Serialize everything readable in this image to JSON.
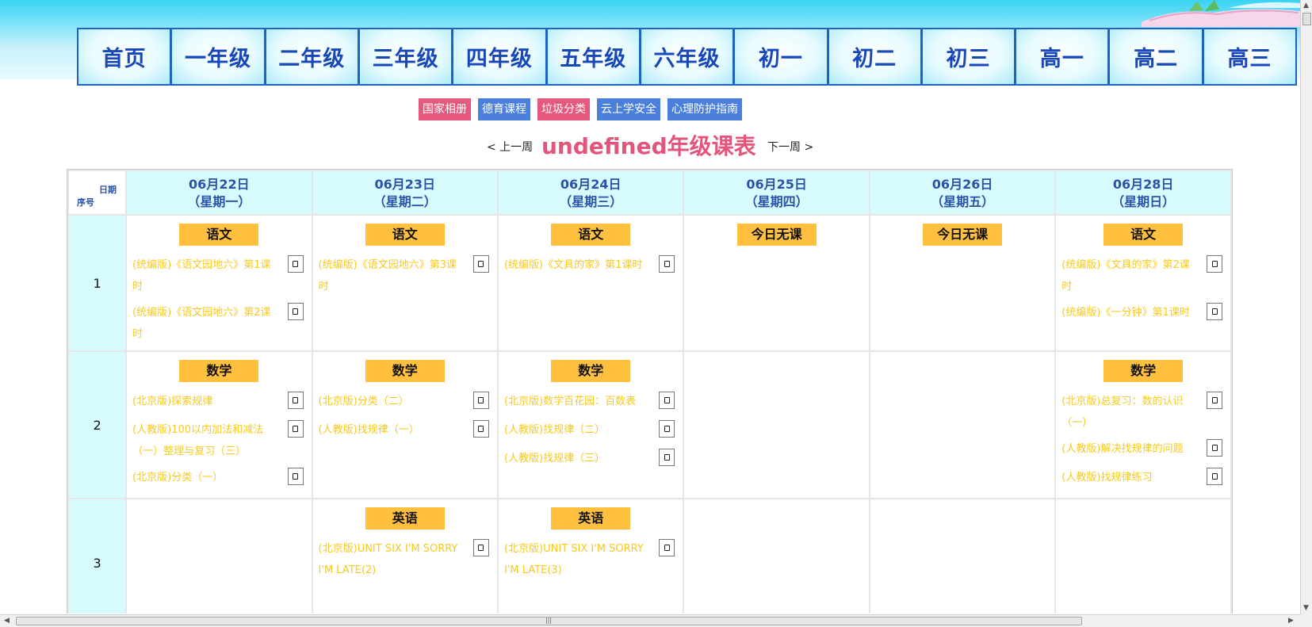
{
  "nav": {
    "tabs": [
      "首页",
      "一年级",
      "二年级",
      "三年级",
      "四年级",
      "五年级",
      "六年级",
      "初一",
      "初二",
      "初三",
      "高一",
      "高二",
      "高三"
    ]
  },
  "links": [
    {
      "label": "国家相册",
      "color": "#e6587e"
    },
    {
      "label": "德育课程",
      "color": "#4a7fdc"
    },
    {
      "label": "垃圾分类",
      "color": "#e6587e"
    },
    {
      "label": "云上学安全",
      "color": "#4a7fdc"
    },
    {
      "label": "心理防护指南",
      "color": "#4a7fdc"
    }
  ],
  "week": {
    "prev_label": "< 上一周",
    "title": "undefined年级课表",
    "next_label": "下一周 >"
  },
  "table": {
    "corner_date": "日期",
    "corner_index": "序号",
    "days": [
      {
        "date": "06月22日",
        "weekday": "（星期一）"
      },
      {
        "date": "06月23日",
        "weekday": "（星期二）"
      },
      {
        "date": "06月24日",
        "weekday": "（星期三）"
      },
      {
        "date": "06月25日",
        "weekday": "（星期四）"
      },
      {
        "date": "06月26日",
        "weekday": "（星期五）"
      },
      {
        "date": "06月28日",
        "weekday": "（星期日）"
      }
    ],
    "rows": [
      {
        "index": "1",
        "cells": [
          {
            "subject": "语文",
            "lessons": [
              "(统编版)《语文园地六》第1课时",
              "(统编版)《语文园地六》第2课时"
            ]
          },
          {
            "subject": "语文",
            "lessons": [
              "(统编版)《语文园地六》第3课时"
            ]
          },
          {
            "subject": "语文",
            "lessons": [
              "(统编版)《文具的家》第1课时"
            ]
          },
          {
            "subject": "今日无课",
            "lessons": []
          },
          {
            "subject": "今日无课",
            "lessons": []
          },
          {
            "subject": "语文",
            "lessons": [
              "(统编版)《文具的家》第2课时",
              "(统编版)《一分钟》第1课时"
            ]
          }
        ]
      },
      {
        "index": "2",
        "cells": [
          {
            "subject": "数学",
            "lessons": [
              "(北京版)探索规律",
              "(人教版)100以内加法和减法（一）整理与复习（三）",
              "(北京版)分类（一）"
            ]
          },
          {
            "subject": "数学",
            "lessons": [
              "(北京版)分类（二）",
              "(人教版)找规律（一）"
            ]
          },
          {
            "subject": "数学",
            "lessons": [
              "(北京版)数学百花园：百数表",
              "(人教版)找规律（二）",
              "(人教版)找规律（三）"
            ]
          },
          {
            "subject": "",
            "lessons": []
          },
          {
            "subject": "",
            "lessons": []
          },
          {
            "subject": "数学",
            "lessons": [
              "(北京版)总复习：数的认识（一）",
              "(人教版)解决找规律的问题",
              "(人教版)找规律练习"
            ]
          }
        ]
      },
      {
        "index": "3",
        "cells": [
          {
            "subject": "",
            "lessons": []
          },
          {
            "subject": "英语",
            "lessons": [
              "(北京版)UNIT SIX I'M SORRY I'M LATE(2)"
            ]
          },
          {
            "subject": "英语",
            "lessons": [
              "(北京版)UNIT SIX I'M SORRY I'M LATE(3)"
            ]
          },
          {
            "subject": "",
            "lessons": []
          },
          {
            "subject": "",
            "lessons": []
          },
          {
            "subject": "",
            "lessons": []
          }
        ]
      }
    ]
  },
  "icons": {
    "lesson_button": "play-video-icon",
    "scroll_grip": "grip-icon"
  },
  "colors": {
    "accent_red": "#e3557a",
    "nav_text": "#1747b8",
    "subject_bg": "#ffc040",
    "lesson_text": "#f7c91f",
    "header_cell": "#d7fbfd"
  }
}
